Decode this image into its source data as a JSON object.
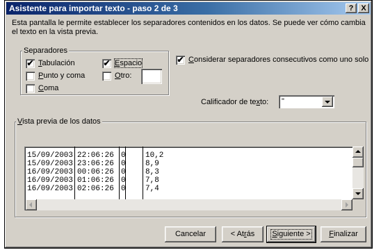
{
  "window": {
    "title": "Asistente para importar texto - paso 2 de 3",
    "help_label": "?",
    "close_label": "X",
    "description": "Esta pantalla le permite establecer los separadores contenidos en los datos. Se puede ver cómo cambia el texto en la vista previa."
  },
  "separators": {
    "legend": "Separadores",
    "tab": {
      "label_pre": "",
      "accel": "T",
      "label_post": "abulación",
      "checked": true
    },
    "semicolon": {
      "label_pre": "",
      "accel": "P",
      "label_post": "unto y coma",
      "checked": false
    },
    "comma": {
      "label_pre": "",
      "accel": "C",
      "label_post": "oma",
      "checked": false
    },
    "space": {
      "label_pre": "",
      "accel": "E",
      "label_post": "spacio",
      "checked": true
    },
    "other": {
      "label_pre": "",
      "accel": "O",
      "label_post": "tro:",
      "checked": false,
      "value": ""
    }
  },
  "consecutive": {
    "label_pre": "",
    "accel": "C",
    "label_post": "onsiderar separadores consecutivos como uno solo",
    "checked": true
  },
  "qualifier": {
    "label_pre": "Calificador de te",
    "accel": "x",
    "label_post": "to:",
    "value": "\""
  },
  "preview": {
    "label_pre": "",
    "accel": "V",
    "label_post": "ista previa de los datos",
    "rows": [
      [
        "15/09/2003",
        "22:06:26",
        "0",
        "10,2"
      ],
      [
        "15/09/2003",
        "23:06:26",
        "0",
        "8,9"
      ],
      [
        "16/09/2003",
        "00:06:26",
        "0",
        "8,3"
      ],
      [
        "16/09/2003",
        "01:06:26",
        "0",
        "7,8"
      ],
      [
        "16/09/2003",
        "02:06:26",
        "0",
        "7,4"
      ]
    ]
  },
  "buttons": {
    "cancel": {
      "label_pre": "Cancelar",
      "accel": "",
      "label_post": ""
    },
    "back": {
      "label_pre": "< At",
      "accel": "r",
      "label_post": "ás"
    },
    "next": {
      "label_pre": "",
      "accel": "S",
      "label_post": "iguiente >"
    },
    "finish": {
      "label_pre": "",
      "accel": "F",
      "label_post": "inalizar"
    }
  },
  "check_glyph": "✔"
}
